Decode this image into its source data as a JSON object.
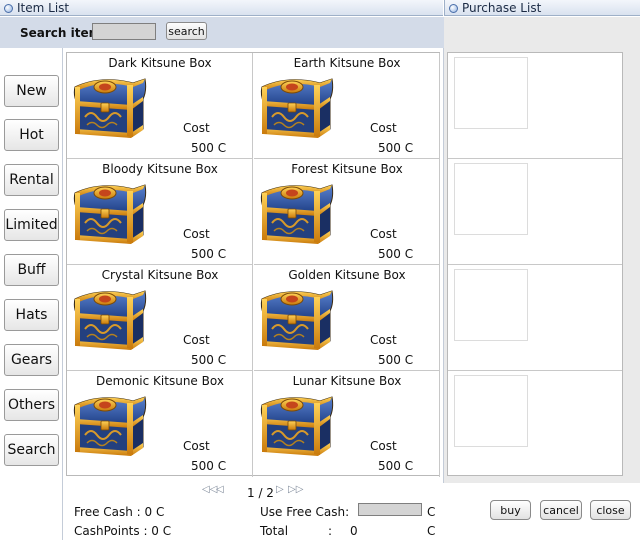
{
  "panels": {
    "item_list_title": "Item List",
    "purchase_list_title": "Purchase List"
  },
  "search": {
    "label": "Search item:",
    "value": "",
    "button": "search"
  },
  "categories": [
    "New",
    "Hot",
    "Rental",
    "Limited",
    "Buff",
    "Hats",
    "Gears",
    "Others",
    "Search"
  ],
  "items": [
    {
      "name": "Dark Kitsune Box",
      "cost_label": "Cost",
      "price": "500 C"
    },
    {
      "name": "Earth Kitsune Box",
      "cost_label": "Cost",
      "price": "500 C"
    },
    {
      "name": "Bloody Kitsune Box",
      "cost_label": "Cost",
      "price": "500 C"
    },
    {
      "name": "Forest Kitsune Box",
      "cost_label": "Cost",
      "price": "500 C"
    },
    {
      "name": "Crystal Kitsune Box",
      "cost_label": "Cost",
      "price": "500 C"
    },
    {
      "name": "Golden Kitsune Box",
      "cost_label": "Cost",
      "price": "500 C"
    },
    {
      "name": "Demonic Kitsune Box",
      "cost_label": "Cost",
      "price": "500 C"
    },
    {
      "name": "Lunar Kitsune Box",
      "cost_label": "Cost",
      "price": "500 C"
    }
  ],
  "pagination": {
    "text": "1 / 2"
  },
  "footer": {
    "free_cash": "Free Cash : 0 C",
    "cash_points": "CashPoints : 0 C",
    "use_free_cash_label": "Use Free Cash:",
    "use_free_cash_unit": "C",
    "total_label": "Total",
    "total_sep": ":",
    "total_value": "0",
    "total_unit": "C"
  },
  "actions": {
    "buy": "buy",
    "cancel": "cancel",
    "close": "close"
  },
  "icons": {
    "item_icon": "treasure-chest-icon",
    "page_first": "double-left-arrow-icon",
    "page_prev": "left-arrow-icon",
    "page_next": "right-arrow-icon",
    "page_last": "double-right-arrow-icon"
  },
  "colors": {
    "chest_blue": "#2c4f9a",
    "chest_gold": "#e8a21c"
  }
}
